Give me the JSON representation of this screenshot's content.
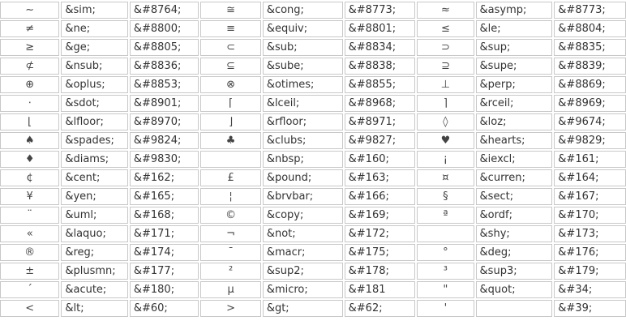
{
  "rows": [
    [
      [
        "~",
        "&sim;",
        "&#8764;"
      ],
      [
        "≅",
        "&cong;",
        "&#8773;"
      ],
      [
        "≈",
        "&asymp;",
        "&#8773;"
      ]
    ],
    [
      [
        "≠",
        "&ne;",
        "&#8800;"
      ],
      [
        "≡",
        "&equiv;",
        "&#8801;"
      ],
      [
        "≤",
        "&le;",
        "&#8804;"
      ]
    ],
    [
      [
        "≥",
        "&ge;",
        "&#8805;"
      ],
      [
        "⊂",
        "&sub;",
        "&#8834;"
      ],
      [
        "⊃",
        "&sup;",
        "&#8835;"
      ]
    ],
    [
      [
        "⊄",
        "&nsub;",
        "&#8836;"
      ],
      [
        "⊆",
        "&sube;",
        "&#8838;"
      ],
      [
        "⊇",
        "&supe;",
        "&#8839;"
      ]
    ],
    [
      [
        "⊕",
        "&oplus;",
        "&#8853;"
      ],
      [
        "⊗",
        "&otimes;",
        "&#8855;"
      ],
      [
        "⊥",
        "&perp;",
        "&#8869;"
      ]
    ],
    [
      [
        "⋅",
        "&sdot;",
        "&#8901;"
      ],
      [
        "⌈",
        "&lceil;",
        "&#8968;"
      ],
      [
        "⌉",
        "&rceil;",
        "&#8969;"
      ]
    ],
    [
      [
        "⌊",
        "&lfloor;",
        "&#8970;"
      ],
      [
        "⌋",
        "&rfloor;",
        "&#8971;"
      ],
      [
        "◊",
        "&loz;",
        "&#9674;"
      ]
    ],
    [
      [
        "♠",
        "&spades;",
        "&#9824;"
      ],
      [
        "♣",
        "&clubs;",
        "&#9827;"
      ],
      [
        "♥",
        "&hearts;",
        "&#9829;"
      ]
    ],
    [
      [
        "♦",
        "&diams;",
        "&#9830;"
      ],
      [
        "",
        "&nbsp;",
        "&#160;"
      ],
      [
        "¡",
        "&iexcl;",
        "&#161;"
      ]
    ],
    [
      [
        "¢",
        "&cent;",
        "&#162;"
      ],
      [
        "£",
        "&pound;",
        "&#163;"
      ],
      [
        "¤",
        "&curren;",
        "&#164;"
      ]
    ],
    [
      [
        "¥",
        "&yen;",
        "&#165;"
      ],
      [
        "¦",
        "&brvbar;",
        "&#166;"
      ],
      [
        "§",
        "&sect;",
        "&#167;"
      ]
    ],
    [
      [
        "¨",
        "&uml;",
        "&#168;"
      ],
      [
        "©",
        "&copy;",
        "&#169;"
      ],
      [
        "ª",
        "&ordf;",
        "&#170;"
      ]
    ],
    [
      [
        "«",
        "&laquo;",
        "&#171;"
      ],
      [
        "¬",
        "&not;",
        "&#172;"
      ],
      [
        "",
        "&shy;",
        "&#173;"
      ]
    ],
    [
      [
        "®",
        "&reg;",
        "&#174;"
      ],
      [
        "¯",
        "&macr;",
        "&#175;"
      ],
      [
        "°",
        "&deg;",
        "&#176;"
      ]
    ],
    [
      [
        "±",
        "&plusmn;",
        "&#177;"
      ],
      [
        "²",
        "&sup2;",
        "&#178;"
      ],
      [
        "³",
        "&sup3;",
        "&#179;"
      ]
    ],
    [
      [
        "´",
        "&acute;",
        "&#180;"
      ],
      [
        "µ",
        "&micro;",
        "&#181"
      ],
      [
        "\"",
        "&quot;",
        "&#34;"
      ]
    ],
    [
      [
        "<",
        "&lt;",
        "&#60;"
      ],
      [
        ">",
        "&gt;",
        "&#62;"
      ],
      [
        "'",
        "",
        "&#39;"
      ]
    ]
  ]
}
